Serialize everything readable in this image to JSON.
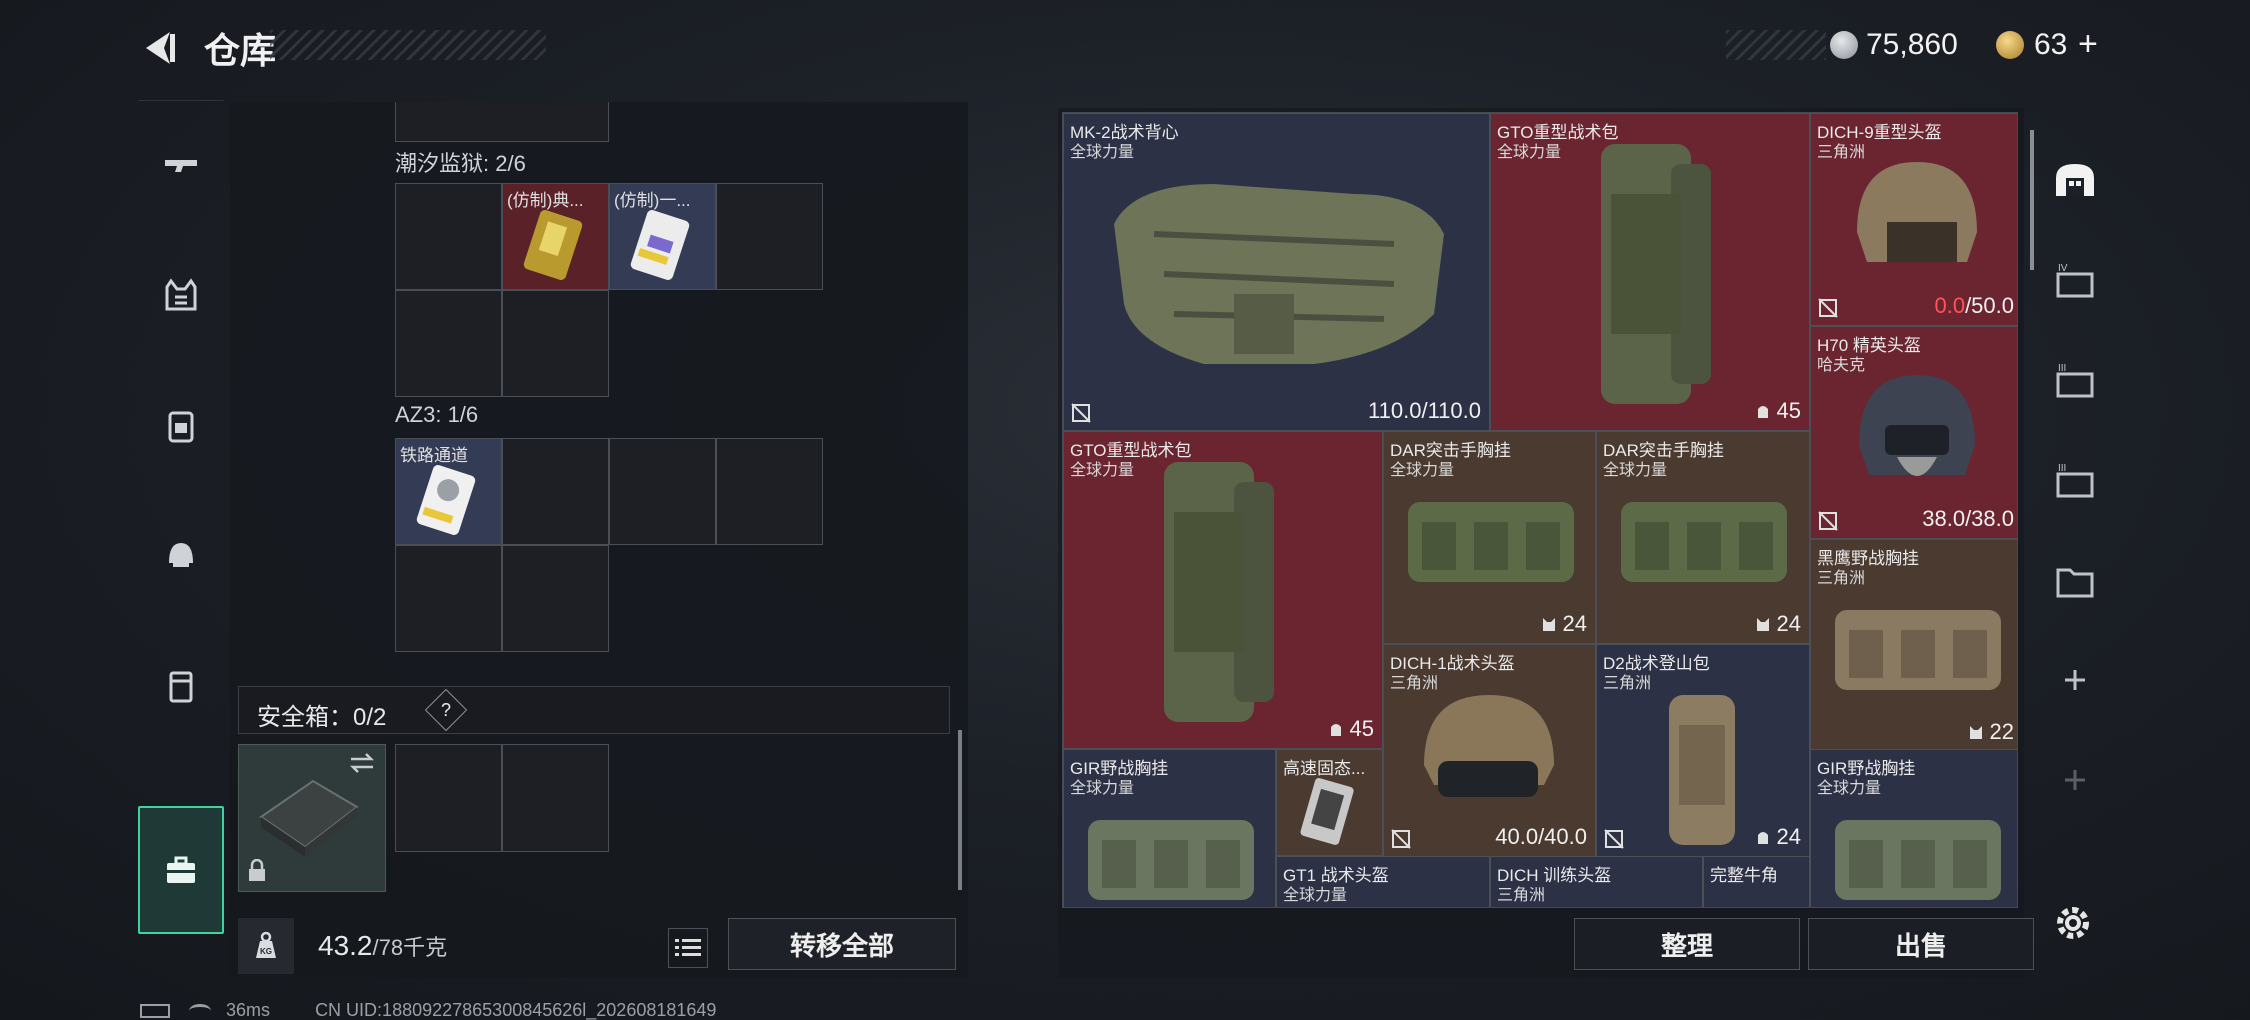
{
  "header": {
    "title": "仓库",
    "currency_primary": "75,860",
    "currency_secondary": "63",
    "add_symbol": "+"
  },
  "nav_rail": {
    "items": [
      {
        "icon": "gun-icon"
      },
      {
        "icon": "vest-icon"
      },
      {
        "icon": "backpack-icon"
      },
      {
        "icon": "helmet-icon"
      },
      {
        "icon": "pouch-icon"
      },
      {
        "icon": "toolbox-icon",
        "active": true
      }
    ]
  },
  "left": {
    "groups": [
      {
        "label": "潮汐监狱: 2/6",
        "items": [
          {
            "label": "(仿制)典..."
          },
          {
            "label": "(仿制)一..."
          }
        ]
      },
      {
        "label": "AZ3: 1/6",
        "items": [
          {
            "label": "铁路通道"
          }
        ]
      }
    ],
    "safe_label": "安全箱：0/2",
    "safe_help": "?",
    "weight_value": "43.2",
    "weight_unit": "/78千克",
    "transfer_all": "转移全部"
  },
  "stash": {
    "items": [
      {
        "name": "MK-2战术背心",
        "sub": "全球力量",
        "value": "110.0/110.0",
        "color": "navy"
      },
      {
        "name": "GTO重型战术包",
        "sub": "全球力量",
        "value": "45",
        "color": "red"
      },
      {
        "name": "DICH-9重型头盔",
        "sub": "三角洲",
        "value_zero": "0.0",
        "value_rest": "/50.0",
        "color": "red"
      },
      {
        "name": "H70 精英头盔",
        "sub": "哈夫克",
        "value": "38.0/38.0",
        "color": "red"
      },
      {
        "name": "GTO重型战术包",
        "sub": "全球力量",
        "value": "45",
        "color": "red"
      },
      {
        "name": "DAR突击手胸挂",
        "sub": "全球力量",
        "value": "24",
        "color": "brown"
      },
      {
        "name": "DAR突击手胸挂",
        "sub": "全球力量",
        "value": "24",
        "color": "brown"
      },
      {
        "name": "黑鹰野战胸挂",
        "sub": "三角洲",
        "value": "22",
        "color": "brown"
      },
      {
        "name": "DICH-1战术头盔",
        "sub": "三角洲",
        "value": "40.0/40.0",
        "color": "brown"
      },
      {
        "name": "D2战术登山包",
        "sub": "三角洲",
        "value": "24",
        "color": "navy"
      },
      {
        "name": "GIR野战胸挂",
        "sub": "全球力量",
        "color": "navy"
      },
      {
        "name": "高速固态...",
        "color": "brown"
      },
      {
        "name": "GIR野战胸挂",
        "sub": "全球力量",
        "color": "navy"
      },
      {
        "name": "GT1 战术头盔",
        "sub": "全球力量",
        "color": "navy"
      },
      {
        "name": "DICH 训练头盔",
        "sub": "三角洲",
        "color": "navy"
      },
      {
        "name": "完整牛角",
        "color": "navy"
      }
    ],
    "sort_label": "整理",
    "sell_label": "出售"
  },
  "status": {
    "ping": "36ms",
    "uid": "CN UID:18809227865300845626l_202608181649"
  }
}
